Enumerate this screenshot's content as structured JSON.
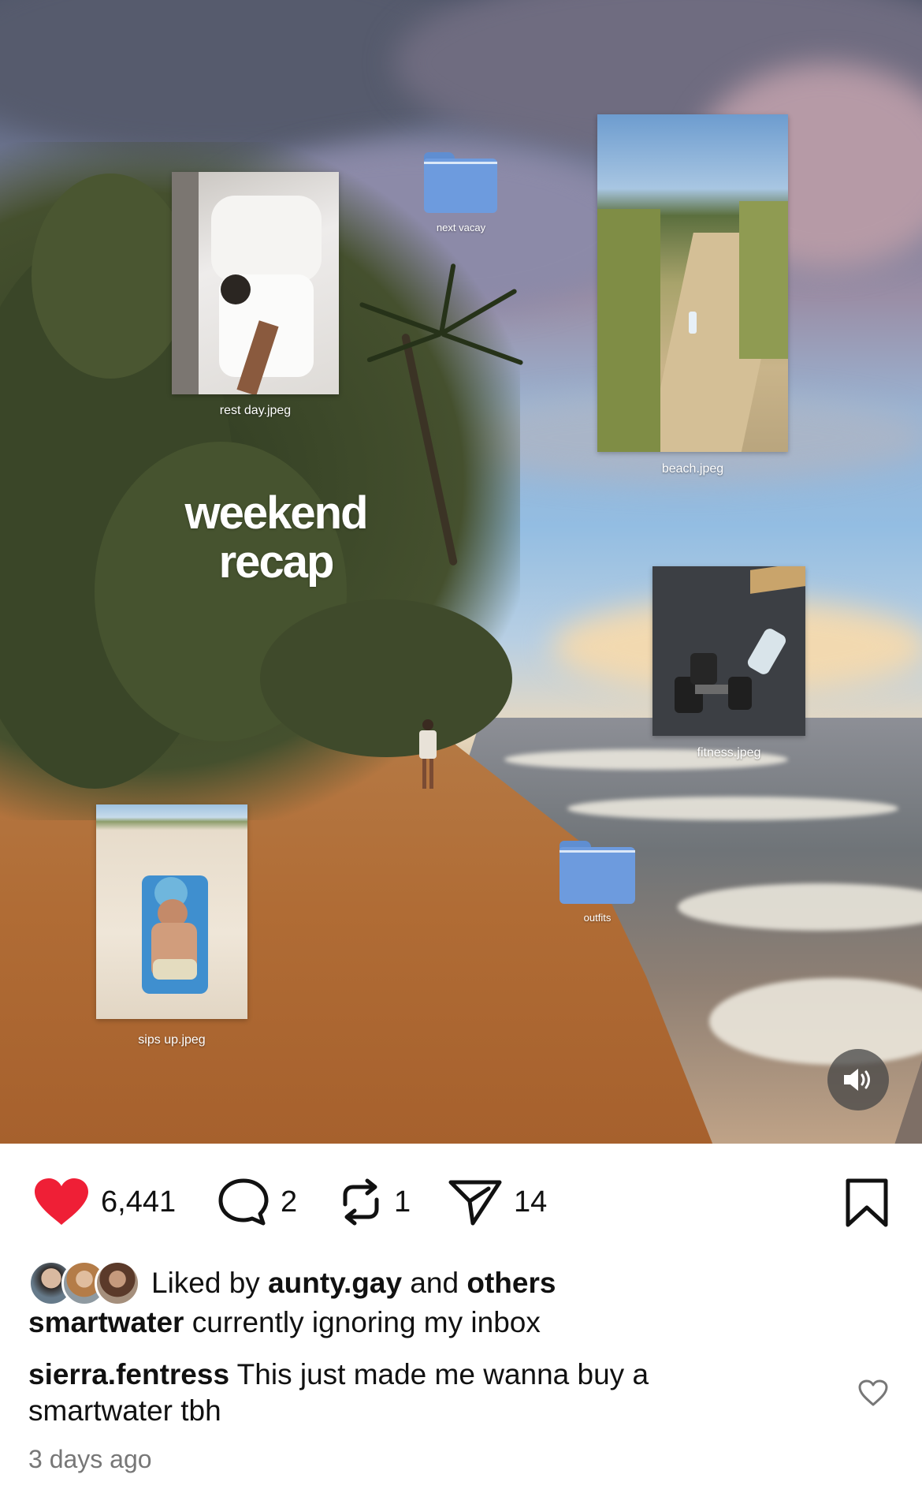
{
  "post": {
    "headline_line1": "weekend",
    "headline_line2": "recap",
    "files": {
      "rest_day": "rest day.jpeg",
      "next_vacay": "next vacay",
      "beach": "beach.jpeg",
      "fitness": "fitness.jpeg",
      "outfits": "outfits",
      "sips_up": "sips up.jpeg"
    },
    "sound_icon": "speaker-on-icon"
  },
  "actions": {
    "likes_count": "6,441",
    "comments_count": "2",
    "reposts_count": "1",
    "shares_count": "14",
    "like_color": "#ef1f36",
    "icons": [
      "heart-icon",
      "comment-icon",
      "repost-icon",
      "send-icon",
      "bookmark-icon"
    ]
  },
  "likes": {
    "prefix": "Liked by",
    "user": "aunty.gay",
    "and": "and",
    "others": "others"
  },
  "caption": {
    "user": "smartwater",
    "text": "currently ignoring my inbox"
  },
  "comment": {
    "user": "sierra.fentress",
    "text": "This just made me wanna buy a smartwater tbh"
  },
  "timestamp": "3 days ago"
}
